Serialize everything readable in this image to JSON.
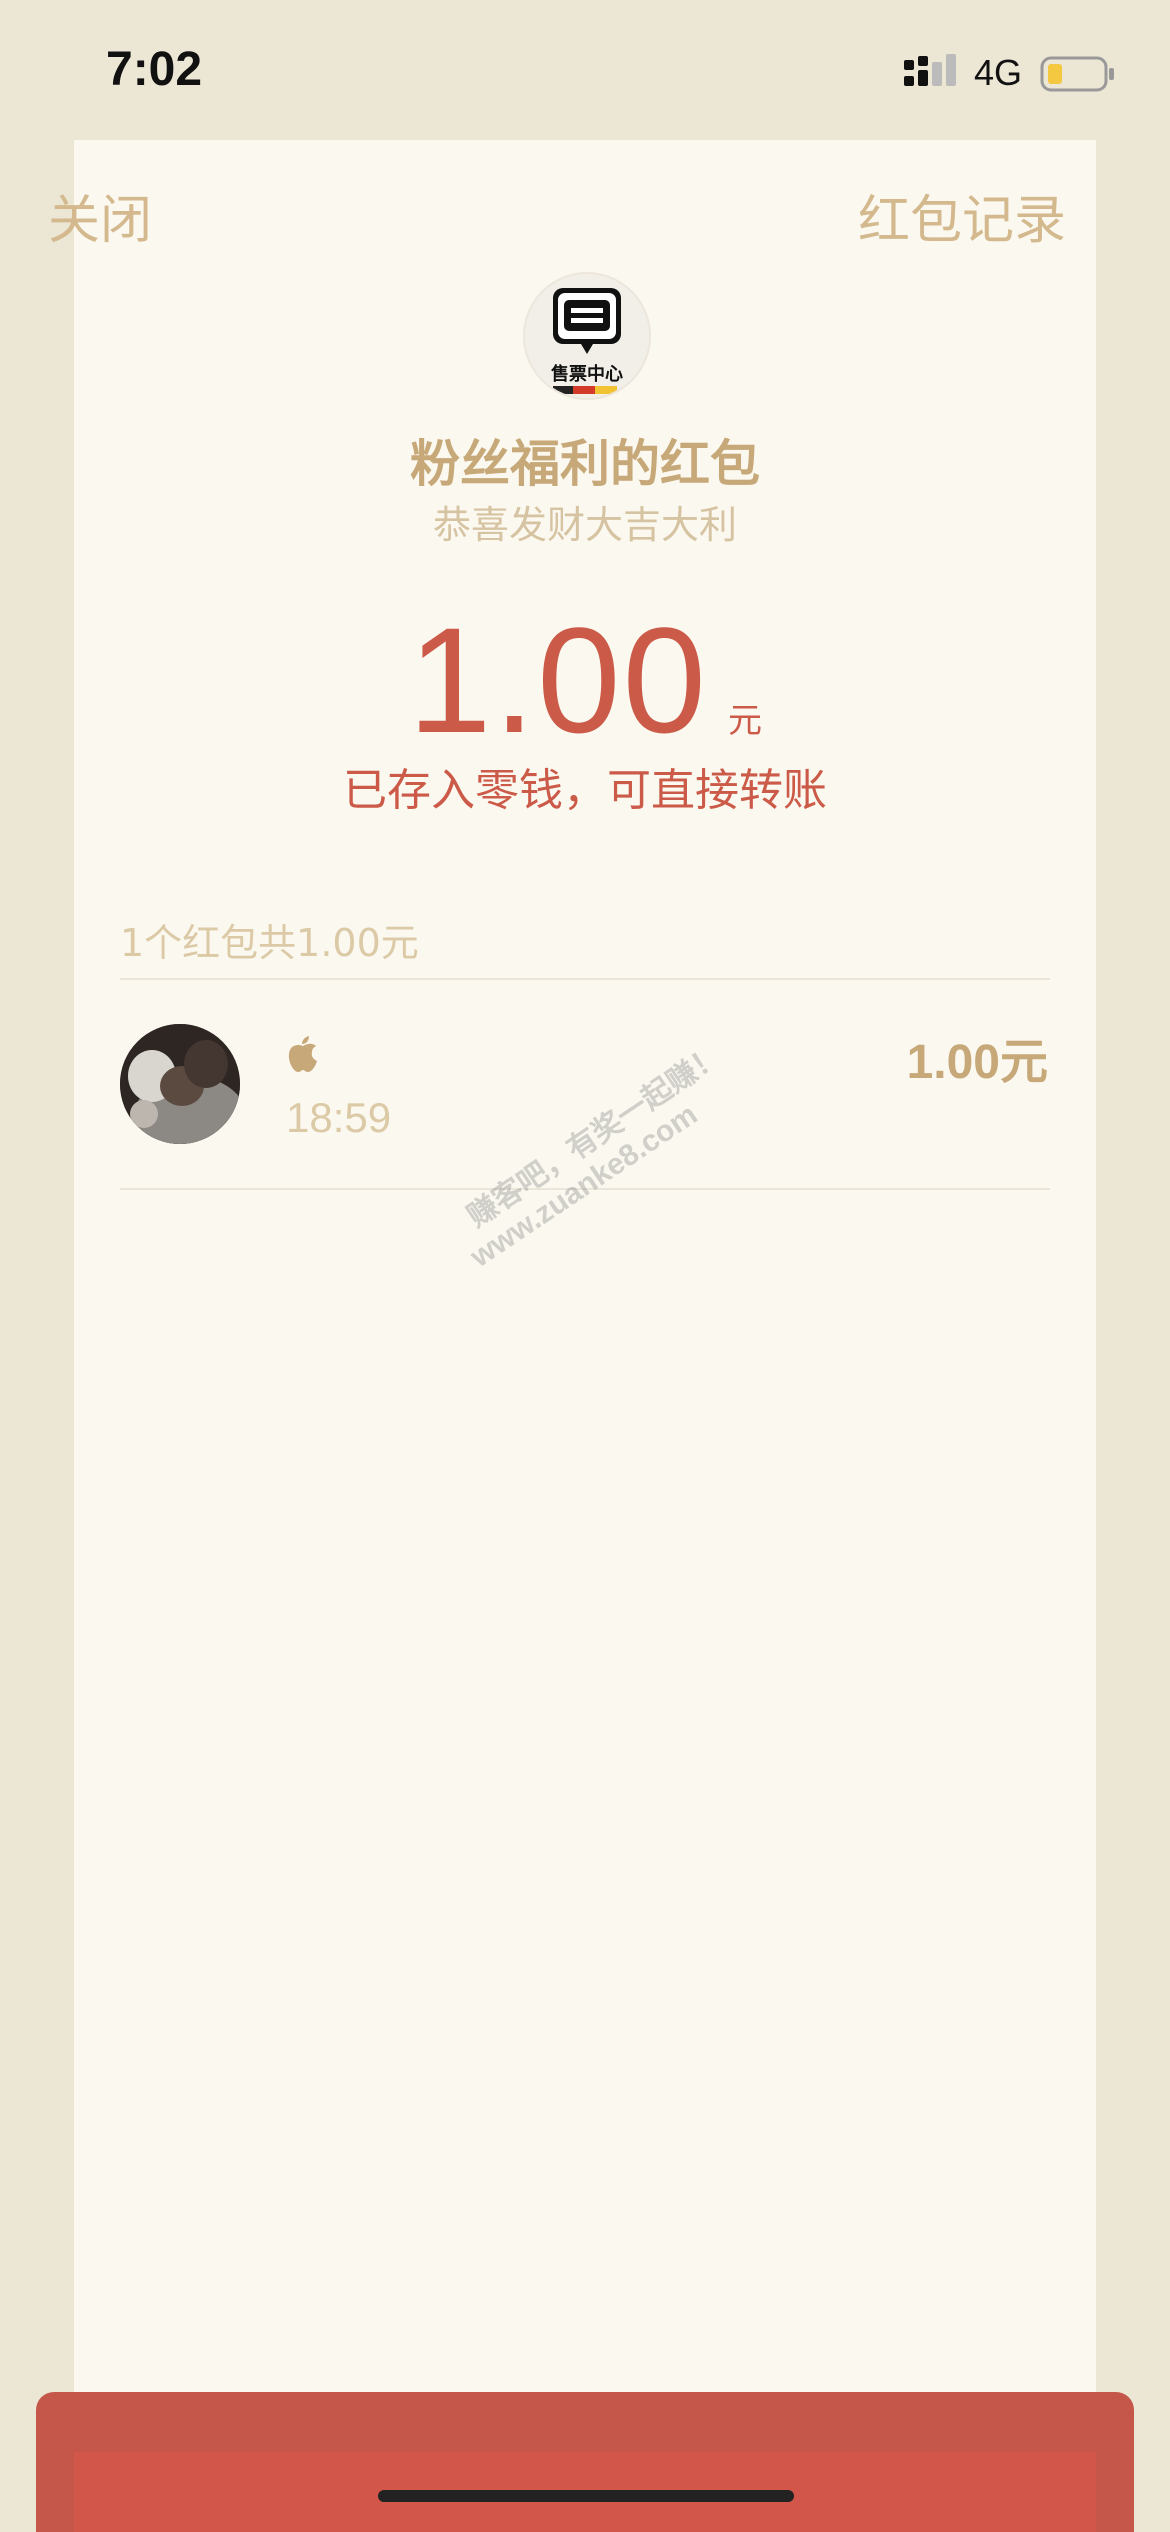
{
  "status_bar": {
    "time": "7:02",
    "network": "4G",
    "signal_icon": "signal-bars-icon",
    "battery_icon": "battery-low-icon",
    "battery_color": "#f5c842"
  },
  "header": {
    "close_label": "关闭",
    "records_label": "红包记录"
  },
  "sender": {
    "avatar_text": "售票中心",
    "name": "粉丝福利的红包",
    "greeting": "恭喜发财大吉大利"
  },
  "amount": {
    "value": "1.00",
    "unit": "元",
    "note": "已存入零钱，可直接转账"
  },
  "summary": "1个红包共1.00元",
  "receivers": [
    {
      "name_icon": "apple-icon",
      "time": "18:59",
      "amount": "1.00",
      "unit": "元"
    }
  ],
  "watermark": {
    "line1": "赚客吧，有奖一起赚！",
    "line2": "www.zuanke8.com"
  },
  "colors": {
    "accent_gold": "#c7a878",
    "amount_red": "#cc5a48",
    "sheet_bg": "#fbf8f0",
    "page_bg": "#ece6d5",
    "bottom_red": "#d2574a"
  }
}
